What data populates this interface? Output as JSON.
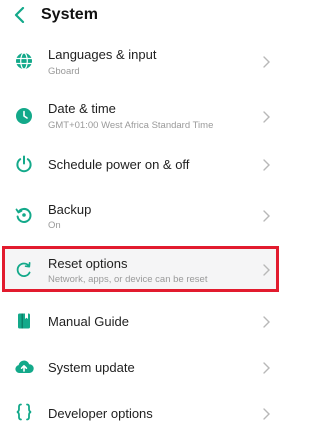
{
  "header": {
    "title": "System"
  },
  "items": [
    {
      "label": "Languages & input",
      "sub": "Gboard",
      "icon": "globe-icon"
    },
    {
      "label": "Date & time",
      "sub": "GMT+01:00 West Africa Standard Time",
      "icon": "clock-icon"
    },
    {
      "label": "Schedule power on & off",
      "sub": "",
      "icon": "power-icon"
    },
    {
      "label": "Backup",
      "sub": "On",
      "icon": "backup-icon"
    },
    {
      "label": "Reset options",
      "sub": "Network, apps, or device can be reset",
      "icon": "reset-icon"
    },
    {
      "label": "Manual Guide",
      "sub": "",
      "icon": "book-icon"
    },
    {
      "label": "System update",
      "sub": "",
      "icon": "cloud-upload-icon"
    },
    {
      "label": "Developer options",
      "sub": "",
      "icon": "braces-icon"
    }
  ],
  "colors": {
    "accent": "#13a98a",
    "highlight_border": "#e21b2e"
  }
}
